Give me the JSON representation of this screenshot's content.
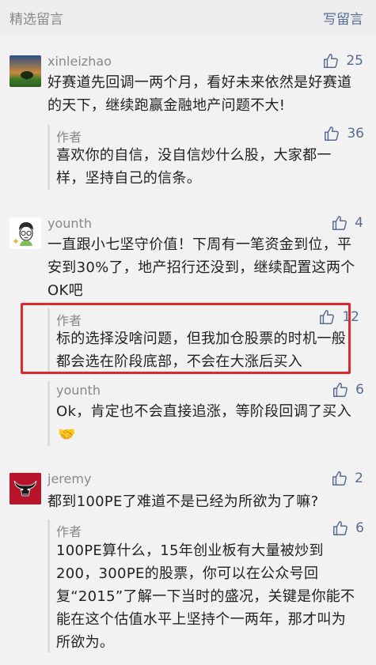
{
  "header": {
    "title": "精选留言",
    "write_label": "写留言"
  },
  "comments": [
    {
      "name": "xinleizhao",
      "likes": "25",
      "text": "好赛道先回调一两个月，看好未来依然是好赛道的天下，继续跑赢金融地产问题不大!",
      "reply": {
        "name": "作者",
        "likes": "36",
        "text": "喜欢你的自信，没自信炒什么股，大家都一样，坚持自己的信条。"
      }
    },
    {
      "name": "younth",
      "likes": "4",
      "text": "一直跟小七坚守价值！下周有一笔资金到位，平安到30%了，地产招行还没到，继续配置这两个OK吧",
      "reply": {
        "name": "作者",
        "likes": "12",
        "text": "标的选择没啥问题，但我加仓股票的时机一般都会选在阶段底部，不会在大涨后买入"
      },
      "reply2": {
        "name": "younth",
        "likes": "6",
        "text": "Ok，肯定也不会直接追涨，等阶段回调了买入",
        "emoji": "🤝"
      }
    },
    {
      "name": "jeremy",
      "likes": "2",
      "text": "都到100PE了难道不是已经为所欲为了嘛?",
      "reply": {
        "name": "作者",
        "likes": "6",
        "text": "100PE算什么，15年创业板有大量被炒到200，300PE的股票，你可以在公众号回复“2015”了解一下当时的盛况，关键是你能不能在这个估值水平上坚持个一两年，那才叫为所欲为。"
      }
    }
  ]
}
